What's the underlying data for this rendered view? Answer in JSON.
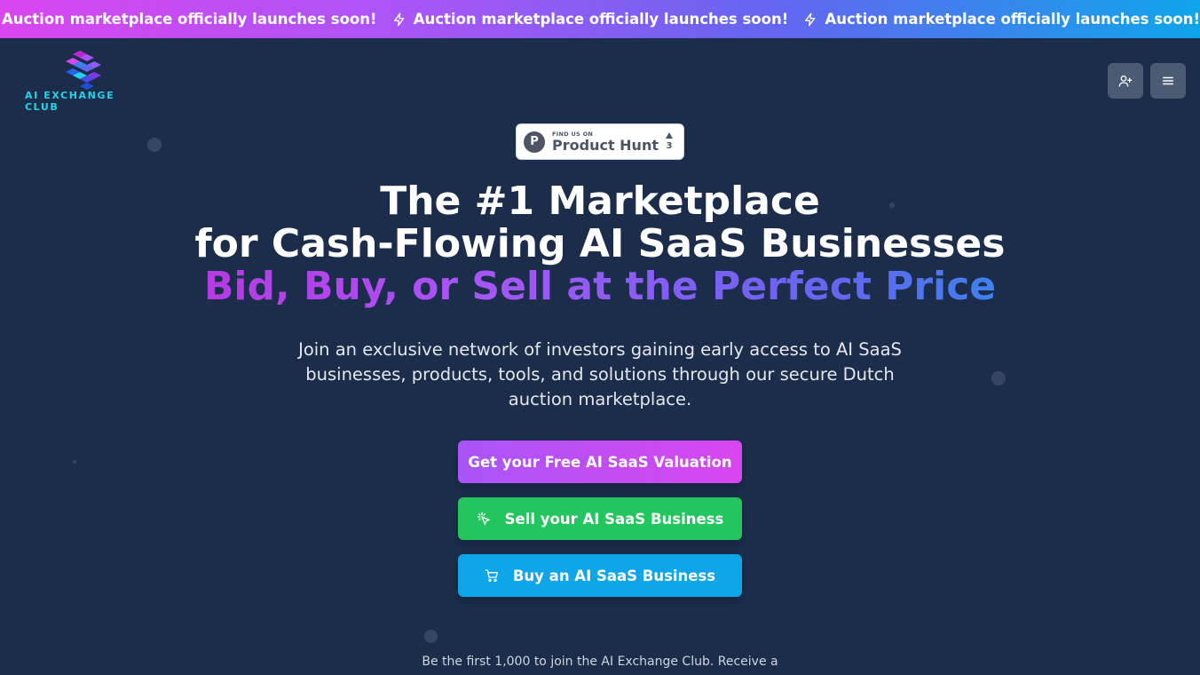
{
  "ticker": {
    "messages": [
      "Auction marketplace officially launches soon!",
      "Auction marketplace officially launches soon!",
      "Auction marketplace officially launches soon!"
    ],
    "icon": "lightning-bolt-icon"
  },
  "header": {
    "logo_text": "AI EXCHANGE CLUB",
    "actions": [
      {
        "name": "add-user-button",
        "icon": "user-plus-icon"
      },
      {
        "name": "menu-button",
        "icon": "hamburger-menu-icon"
      }
    ]
  },
  "product_hunt": {
    "find_label": "FIND US ON",
    "name": "Product Hunt",
    "upvotes": "3",
    "logo_letter": "P"
  },
  "hero": {
    "line1": "The #1 Marketplace",
    "line2": "for Cash-Flowing AI SaaS Businesses",
    "line3": "Bid, Buy, or Sell at the Perfect Price",
    "subtitle": "Join an exclusive network of investors gaining early access to AI SaaS businesses, products, tools, and solutions through our secure Dutch auction marketplace."
  },
  "cta": {
    "valuation": "Get your Free AI SaaS Valuation",
    "sell": "Sell your AI SaaS Business",
    "sell_icon": "cursor-click-icon",
    "buy": "Buy an AI SaaS Business",
    "buy_icon": "shopping-cart-icon"
  },
  "footnote": "Be the first 1,000 to join the AI Exchange Club. Receive a",
  "colors": {
    "background": "#1b2d4a",
    "accent_purple": "#a855f7",
    "accent_pink": "#d946ef",
    "accent_blue": "#0ea5e9",
    "accent_green": "#22c55e",
    "logo_cyan": "#22d3ee"
  }
}
